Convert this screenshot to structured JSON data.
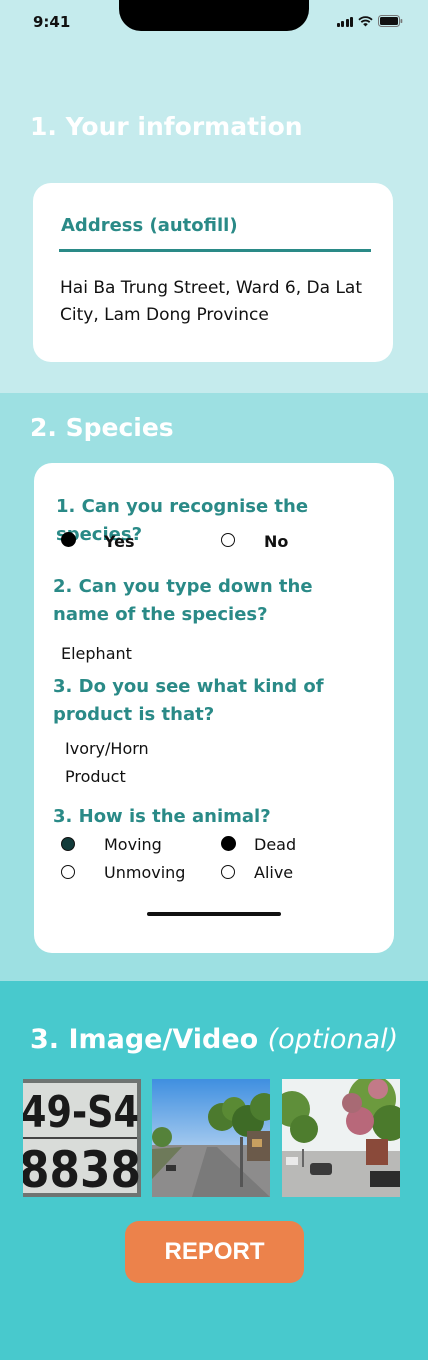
{
  "status": {
    "time": "9:41"
  },
  "section1": {
    "title": "1. Your information",
    "address_label": "Address (autofill)",
    "address_value": "Hai Ba Trung Street, Ward 6, Da Lat City, Lam Dong Province"
  },
  "section2": {
    "title": "2. Species",
    "q1": {
      "text": "1.  Can you recognise the species?",
      "opt_yes": "Yes",
      "opt_no": "No",
      "selected": "Yes"
    },
    "q2": {
      "text": "2. Can you type down the name of the species?",
      "answer": "Elephant"
    },
    "q3": {
      "text": "3. Do you see what kind of product is that?",
      "answer": "Ivory/Horn Product"
    },
    "q4": {
      "text": "3. How is the animal?",
      "opt_moving": "Moving",
      "opt_dead": "Dead",
      "opt_unmoving": "Unmoving",
      "opt_alive": "Alive",
      "selected": [
        "Moving",
        "Dead"
      ]
    }
  },
  "section3": {
    "title": "3.  Image/Video",
    "title_optional": "(optional)",
    "images": [
      {
        "name": "license-plate-photo",
        "plate_line1": "49-S4",
        "plate_line2": "8838"
      },
      {
        "name": "street-photo"
      },
      {
        "name": "tree-street-photo"
      }
    ],
    "report_label": "REPORT"
  },
  "colors": {
    "section1_bg": "#c5ebed",
    "section2_bg": "#9de0e2",
    "section3_bg": "#48c9cd",
    "accent_teal": "#2a8a87",
    "report_button": "#ec824b"
  }
}
